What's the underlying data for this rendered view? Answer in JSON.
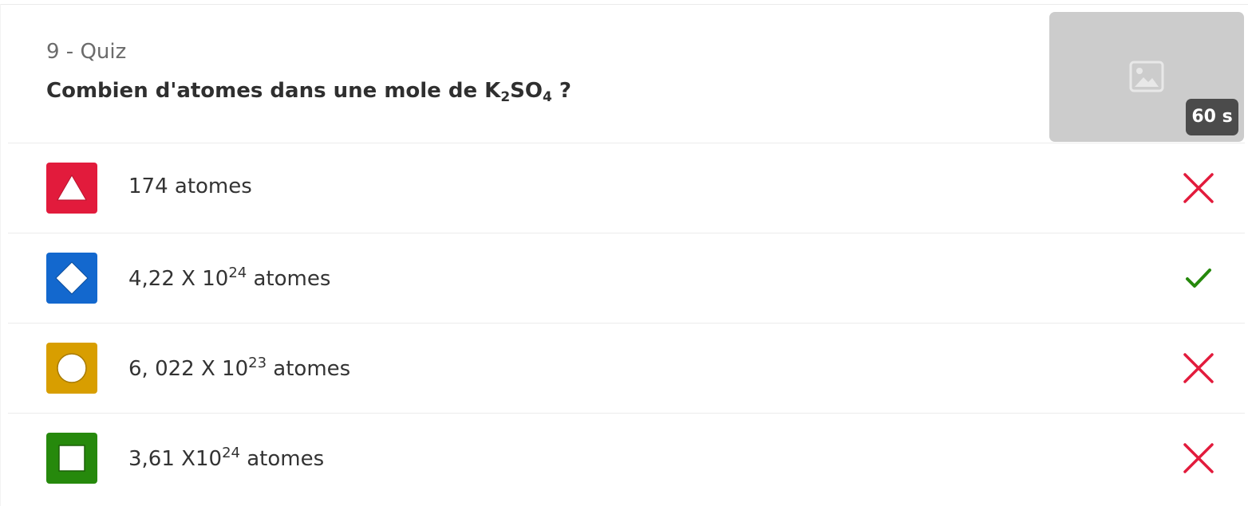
{
  "quiz": {
    "number_label": "9 - Quiz",
    "question": {
      "prefix": "Combien d'atomes dans une mole de K",
      "sub1": "2",
      "mid": "SO",
      "sub2": "4",
      "suffix": " ?"
    },
    "media": {
      "icon": "image-placeholder-icon",
      "timer": "60 s"
    }
  },
  "answers": [
    {
      "shape": "triangle",
      "shape_color": "#e21b3c",
      "text": {
        "base": "174 atomes",
        "sup": "",
        "suffix": ""
      },
      "correct": false
    },
    {
      "shape": "diamond",
      "shape_color": "#1368ce",
      "text": {
        "base": "4,22 X 10",
        "sup": "24",
        "suffix": " atomes"
      },
      "correct": true
    },
    {
      "shape": "circle",
      "shape_color": "#d89e00",
      "text": {
        "base": "6, 022 X 10",
        "sup": "23",
        "suffix": " atomes"
      },
      "correct": false
    },
    {
      "shape": "square",
      "shape_color": "#26890c",
      "text": {
        "base": "3,61 X10",
        "sup": "24",
        "suffix": " atomes"
      },
      "correct": false
    }
  ],
  "colors": {
    "incorrect": "#e21b3c",
    "correct": "#26890c",
    "timer_bg": "#4b4b4b",
    "media_bg": "#cccccc"
  }
}
